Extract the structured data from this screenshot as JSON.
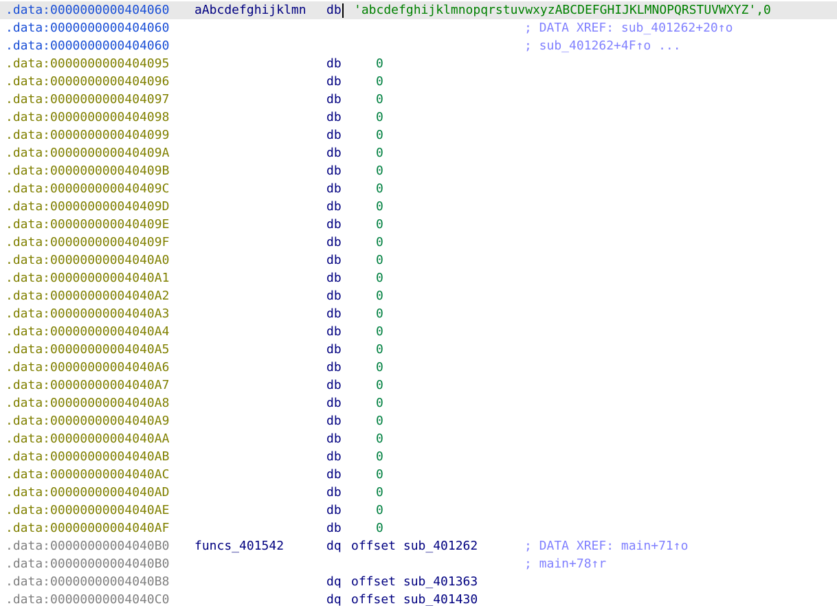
{
  "colors": {
    "address_blue": "#1a4fd6",
    "address_olive": "#808000",
    "address_gray": "#808080",
    "name": "#000080",
    "mnemonic": "#000080",
    "string": "#008000",
    "number": "#008040",
    "comment": "#8080ff",
    "highlight_bg": "#e8e8e8"
  },
  "lines": [
    {
      "addr": ".data:0000000000404060",
      "name": "aAbcdefghijklmn",
      "mnem": "db",
      "str": "'abcdefghijklmnopqrstuvwxyzABCDEFGHIJKLMNOPQRSTUVWXYZ',0",
      "comment": ""
    },
    {
      "addr": ".data:0000000000404060",
      "comment": "; DATA XREF: sub_401262+20↑o"
    },
    {
      "addr": ".data:0000000000404060",
      "comment": "; sub_401262+4F↑o ..."
    },
    {
      "addr": ".data:0000000000404095",
      "mnem": "db",
      "val": "0"
    },
    {
      "addr": ".data:0000000000404096",
      "mnem": "db",
      "val": "0"
    },
    {
      "addr": ".data:0000000000404097",
      "mnem": "db",
      "val": "0"
    },
    {
      "addr": ".data:0000000000404098",
      "mnem": "db",
      "val": "0"
    },
    {
      "addr": ".data:0000000000404099",
      "mnem": "db",
      "val": "0"
    },
    {
      "addr": ".data:000000000040409A",
      "mnem": "db",
      "val": "0"
    },
    {
      "addr": ".data:000000000040409B",
      "mnem": "db",
      "val": "0"
    },
    {
      "addr": ".data:000000000040409C",
      "mnem": "db",
      "val": "0"
    },
    {
      "addr": ".data:000000000040409D",
      "mnem": "db",
      "val": "0"
    },
    {
      "addr": ".data:000000000040409E",
      "mnem": "db",
      "val": "0"
    },
    {
      "addr": ".data:000000000040409F",
      "mnem": "db",
      "val": "0"
    },
    {
      "addr": ".data:00000000004040A0",
      "mnem": "db",
      "val": "0"
    },
    {
      "addr": ".data:00000000004040A1",
      "mnem": "db",
      "val": "0"
    },
    {
      "addr": ".data:00000000004040A2",
      "mnem": "db",
      "val": "0"
    },
    {
      "addr": ".data:00000000004040A3",
      "mnem": "db",
      "val": "0"
    },
    {
      "addr": ".data:00000000004040A4",
      "mnem": "db",
      "val": "0"
    },
    {
      "addr": ".data:00000000004040A5",
      "mnem": "db",
      "val": "0"
    },
    {
      "addr": ".data:00000000004040A6",
      "mnem": "db",
      "val": "0"
    },
    {
      "addr": ".data:00000000004040A7",
      "mnem": "db",
      "val": "0"
    },
    {
      "addr": ".data:00000000004040A8",
      "mnem": "db",
      "val": "0"
    },
    {
      "addr": ".data:00000000004040A9",
      "mnem": "db",
      "val": "0"
    },
    {
      "addr": ".data:00000000004040AA",
      "mnem": "db",
      "val": "0"
    },
    {
      "addr": ".data:00000000004040AB",
      "mnem": "db",
      "val": "0"
    },
    {
      "addr": ".data:00000000004040AC",
      "mnem": "db",
      "val": "0"
    },
    {
      "addr": ".data:00000000004040AD",
      "mnem": "db",
      "val": "0"
    },
    {
      "addr": ".data:00000000004040AE",
      "mnem": "db",
      "val": "0"
    },
    {
      "addr": ".data:00000000004040AF",
      "mnem": "db",
      "val": "0"
    },
    {
      "addr": ".data:00000000004040B0",
      "name": "funcs_401542",
      "mnem": "dq",
      "off": "offset sub_401262",
      "comment": "; DATA XREF: main+71↑o"
    },
    {
      "addr": ".data:00000000004040B0",
      "comment": "; main+78↑r"
    },
    {
      "addr": ".data:00000000004040B8",
      "mnem": "dq",
      "off": "offset sub_401363"
    },
    {
      "addr": ".data:00000000004040C0",
      "mnem": "dq",
      "off": "offset sub_401430"
    }
  ]
}
